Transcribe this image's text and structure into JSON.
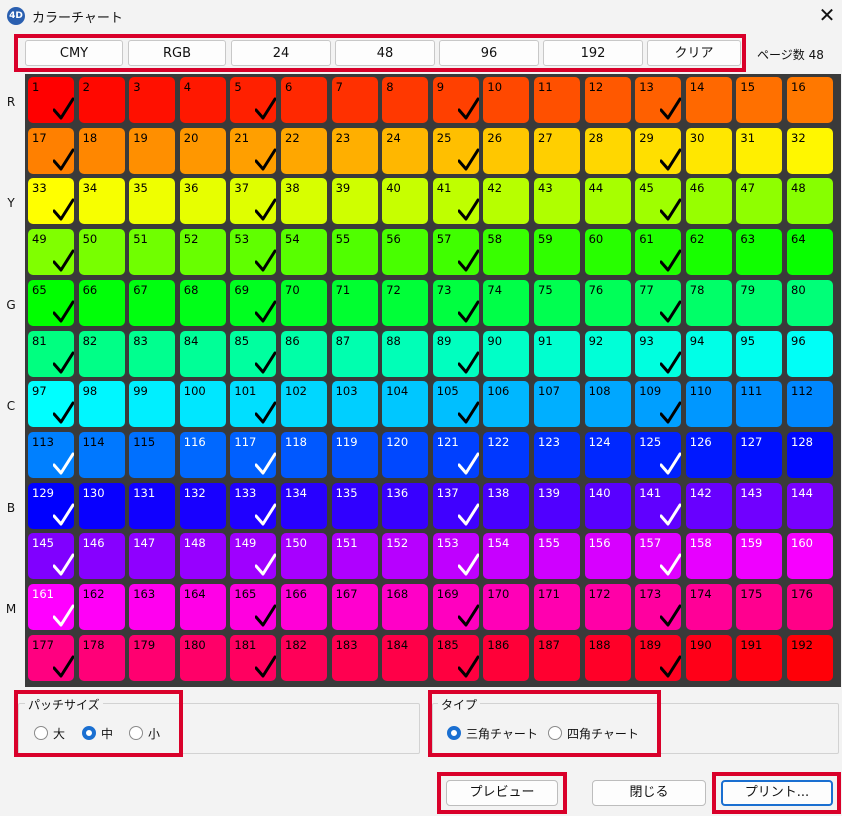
{
  "window": {
    "title": "カラーチャート",
    "icon_label": "4D",
    "close_glyph": "✕"
  },
  "toolbar": {
    "buttons": [
      "CMY",
      "RGB",
      "24",
      "48",
      "96",
      "192",
      "クリア"
    ],
    "page_count": "ページ数 48"
  },
  "row_labels": {
    "R": "R",
    "Y": "Y",
    "G": "G",
    "C": "C",
    "B": "B",
    "M": "M"
  },
  "grid": {
    "columns": 16,
    "rows": 12,
    "count": 192,
    "check_every": 4,
    "hue_start_deg": 0,
    "hue_step_deg": 1.875
  },
  "patch_size": {
    "label": "パッチサイズ",
    "options": [
      "大",
      "中",
      "小"
    ],
    "selected": "中"
  },
  "chart_type": {
    "label": "タイプ",
    "options": [
      "三角チャート",
      "四角チャート"
    ],
    "selected": "三角チャート"
  },
  "buttons": {
    "preview": "プレビュー",
    "close": "閉じる",
    "print": "プリント..."
  },
  "colors": {
    "highlight": "#d9002a",
    "accent": "#1a6fd1",
    "grid_bg": "#3a3a3a"
  }
}
